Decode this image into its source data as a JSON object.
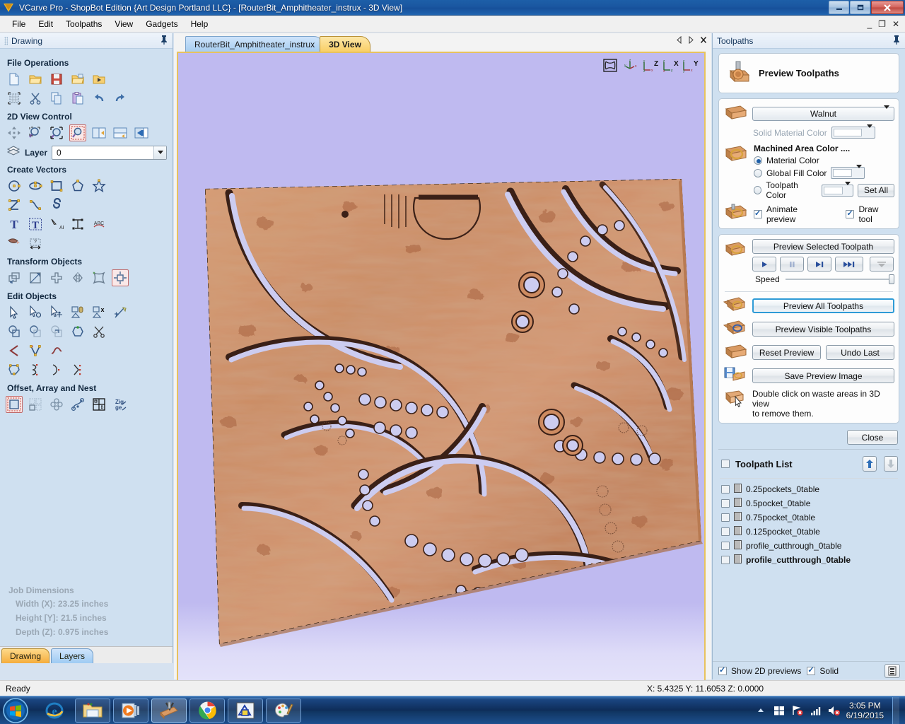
{
  "window": {
    "title": "VCarve Pro - ShopBot Edition {Art Design Portland LLC} - [RouterBit_Amphitheater_instrux - 3D View]",
    "app_icon": "vcarve-logo-icon",
    "minimize": "—",
    "maximize": "❐",
    "close": "✕",
    "mdi_minimize": "_",
    "mdi_restore": "❐",
    "mdi_close": "✕"
  },
  "menu": {
    "items": [
      "File",
      "Edit",
      "Toolpaths",
      "View",
      "Gadgets",
      "Help"
    ]
  },
  "sidebar": {
    "caption": "Drawing",
    "pin_icon": "pin-icon",
    "sections": [
      {
        "title": "File Operations",
        "rows": [
          [
            "new-file-icon",
            "open-folder-icon",
            "save-icon",
            "open-recent-icon",
            "import-icon"
          ],
          [
            "job-setup-icon",
            "cut-icon",
            "copy-icon",
            "paste-icon",
            "undo-icon",
            "redo-icon"
          ]
        ]
      },
      {
        "title": "2D View Control",
        "rows": [
          [
            "pan-icon",
            "zoom-window-icon",
            "zoom-extents-icon",
            "zoom-selected-icon",
            "toggle-left-pane-icon",
            "toggle-top-pane-icon",
            "toggle-right-pane-icon"
          ]
        ]
      },
      {
        "title": "Create Vectors",
        "rows": [
          [
            "circle-icon",
            "ellipse-icon",
            "rectangle-icon",
            "polygon-icon",
            "star-icon"
          ],
          [
            "polyline-icon",
            "curve-icon",
            "spiral-icon"
          ],
          [
            "text-tool-icon",
            "text-box-icon",
            "text-on-curve-icon",
            "text-transform-icon",
            "arc-text-icon"
          ],
          [
            "trace-bitmap-icon",
            "dimension-icon"
          ]
        ]
      },
      {
        "title": "Transform Objects",
        "rows": [
          [
            "move-icon",
            "scale-icon",
            "rotate-icon",
            "mirror-icon",
            "distort-icon",
            "align-icon"
          ]
        ]
      },
      {
        "title": "Edit Objects",
        "rows": [
          [
            "select-node-icon",
            "node-edit-icon",
            "move-nodes-icon",
            "measure-attach-icon",
            "delete-object-icon",
            "trim-icon"
          ],
          [
            "weld-icon",
            "subtract-icon",
            "intersect-icon",
            "join-vectors-icon",
            "scissors-icon"
          ],
          [
            "fillet-icon",
            "node-tools-icon",
            "smooth-curve-icon"
          ],
          [
            "closed-vector-icon",
            "open-vector-icon",
            "curve-fit-icon",
            "node-split-icon"
          ]
        ]
      },
      {
        "title": "Offset, Array and Nest",
        "rows": [
          [
            "offset-icon",
            "array-copy-icon",
            "circular-array-icon",
            "copy-along-curve-icon",
            "block-copy-icon",
            "nest-icon"
          ]
        ]
      }
    ],
    "layer": {
      "label": "Layer",
      "icon": "layers-icon",
      "value": "0"
    },
    "job_dimensions": {
      "title": "Job Dimensions",
      "width": "Width  (X): 23.25 inches",
      "height": "Height [Y]: 21.5 inches",
      "depth": "Depth  (Z): 0.975 inches"
    },
    "tabs": [
      {
        "label": "Drawing",
        "active": true
      },
      {
        "label": "Layers",
        "active": false
      }
    ]
  },
  "document": {
    "tabs": [
      {
        "label": "RouterBit_Amphitheater_instrux",
        "active": false
      },
      {
        "label": "3D View",
        "active": true
      }
    ],
    "tab_controls": [
      "prev-tab-icon",
      "next-tab-icon",
      "close-tab-icon"
    ],
    "view_icons": [
      "isometric-view-icon",
      "perspective-view-icon",
      "view-along-z-icon",
      "view-along-x-icon",
      "view-along-y-icon"
    ],
    "view_icon_labels": [
      "",
      "",
      "Z",
      "X",
      "Y"
    ]
  },
  "toolpaths_panel": {
    "caption": "Toolpaths",
    "pin_icon": "pin-icon",
    "preview_header": {
      "icon": "router-bit-icon",
      "title": "Preview Toolpaths"
    },
    "material": {
      "icon": "material-block-icon",
      "selected": "Walnut",
      "solid_material_color_label": "Solid Material Color",
      "solid_material_color_value": "#ffffff"
    },
    "machined_area": {
      "icon": "machined-area-icon",
      "title": "Machined Area Color ....",
      "options": [
        {
          "label": "Material Color",
          "selected": true
        },
        {
          "label": "Global Fill Color",
          "selected": false,
          "swatch": "#ffffff"
        },
        {
          "label": "Toolpath Color",
          "selected": false,
          "swatch": "#ffffff"
        }
      ],
      "set_all_label": "Set All"
    },
    "checkboxes": [
      {
        "label": "Animate preview",
        "checked": true
      },
      {
        "label": "Draw tool",
        "checked": true
      }
    ],
    "preview_controls": {
      "icon": "preview-single-icon",
      "selected_button": "Preview Selected Toolpath",
      "transport": [
        {
          "name": "play-button",
          "glyph": "▶",
          "enabled": true
        },
        {
          "name": "pause-button",
          "glyph": "❚❚",
          "enabled": false
        },
        {
          "name": "step-button",
          "glyph": "▶❘",
          "enabled": true
        },
        {
          "name": "fast-forward-button",
          "glyph": "▶▶❘",
          "enabled": true
        },
        {
          "name": "finish-button",
          "glyph": "⊼",
          "enabled": false
        }
      ],
      "speed_label": "Speed",
      "speed_value": 100
    },
    "buttons": {
      "preview_all": "Preview All Toolpaths",
      "preview_visible": "Preview Visible Toolpaths",
      "reset_preview": "Reset Preview",
      "undo_last": "Undo Last",
      "save_preview_image": "Save Preview Image",
      "close": "Close"
    },
    "hint": {
      "icon": "waste-area-icon",
      "line1": "Double click on waste areas in 3D view",
      "line2": "to remove them."
    },
    "toolpath_list": {
      "title": "Toolpath List",
      "header_checked": false,
      "move_up_icon": "arrow-up-icon",
      "move_down_icon": "arrow-down-icon",
      "items": [
        {
          "label": "0.25pockets_0table",
          "checked": false,
          "bold": false
        },
        {
          "label": "0.5pocket_0table",
          "checked": false,
          "bold": false
        },
        {
          "label": "0.75pocket_0table",
          "checked": false,
          "bold": false
        },
        {
          "label": "0.125pocket_0table",
          "checked": false,
          "bold": false
        },
        {
          "label": "profile_cutthrough_0table",
          "checked": false,
          "bold": false
        },
        {
          "label": "profile_cutthrough_0table",
          "checked": false,
          "bold": true
        }
      ]
    },
    "bottom": {
      "show_2d_previews": {
        "label": "Show 2D previews",
        "checked": true
      },
      "solid": {
        "label": "Solid",
        "checked": true
      },
      "list_icon": "toolpath-summary-icon"
    }
  },
  "statusbar": {
    "ready": "Ready",
    "coordinates": "X:  5.4325 Y: 11.6053 Z:  0.0000"
  },
  "taskbar": {
    "start_icon": "windows-start-icon",
    "items": [
      {
        "name": "internet-explorer-icon",
        "framed": false
      },
      {
        "name": "file-explorer-icon",
        "framed": true
      },
      {
        "name": "media-player-icon",
        "framed": true
      },
      {
        "name": "vcarve-pro-icon",
        "framed": true,
        "active": true
      },
      {
        "name": "google-chrome-icon",
        "framed": true
      },
      {
        "name": "design-app-icon",
        "framed": true
      },
      {
        "name": "paint-icon",
        "framed": true
      }
    ],
    "tray": {
      "show_hidden_icon": "chevron-up-icon",
      "icons": [
        "action-center-icon",
        "network-error-icon",
        "signal-icon",
        "volume-muted-icon"
      ],
      "time": "3:05 PM",
      "date": "6/19/2015"
    }
  },
  "colors": {
    "accent": "#1e5fa8",
    "viewport_background": "#bfbaf0",
    "material_wood": "#cd8b61",
    "cut_through": "#ccccf0",
    "tab_active": "#f9cf66",
    "highlight_border": "#2e9bd6"
  },
  "model": {
    "description": "3D preview of machined walnut board with amphitheater seating arc pockets",
    "width_label": "23.25 inches",
    "height_label": "21.5 inches"
  }
}
